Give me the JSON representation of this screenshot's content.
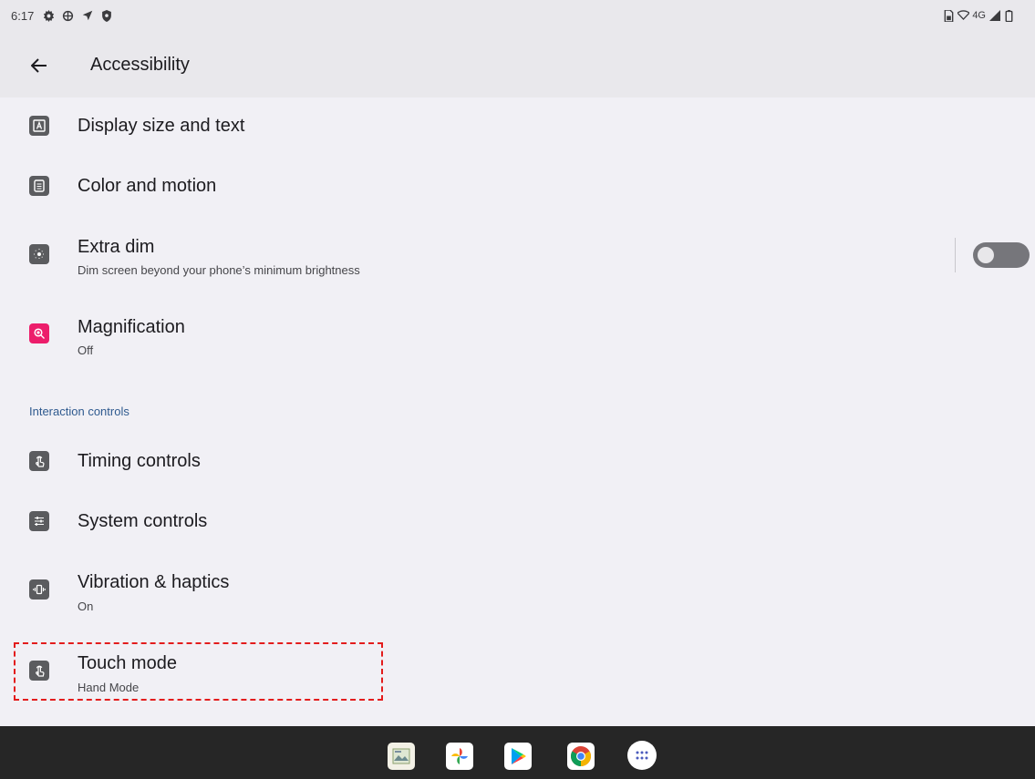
{
  "status_bar": {
    "time": "6:17",
    "network": "4G"
  },
  "app_bar": {
    "title": "Accessibility"
  },
  "items": [
    {
      "title": "Display size and text",
      "subtitle": "",
      "icon": "display-size-icon"
    },
    {
      "title": "Color and motion",
      "subtitle": "",
      "icon": "color-motion-icon"
    },
    {
      "title": "Extra dim",
      "subtitle": "Dim screen beyond your phone’s minimum brightness",
      "icon": "extra-dim-icon",
      "toggle_on": false
    },
    {
      "title": "Magnification",
      "subtitle": "Off",
      "icon": "magnification-icon"
    }
  ],
  "section_interaction": {
    "header": "Interaction controls",
    "items": [
      {
        "title": "Timing controls",
        "subtitle": "",
        "icon": "timing-icon"
      },
      {
        "title": "System controls",
        "subtitle": "",
        "icon": "system-controls-icon"
      },
      {
        "title": "Vibration & haptics",
        "subtitle": "On",
        "icon": "vibration-icon"
      },
      {
        "title": "Touch mode",
        "subtitle": "Hand Mode",
        "icon": "touch-mode-icon",
        "highlighted": true
      }
    ]
  },
  "dock": {
    "apps": [
      "gallery-app-icon",
      "photos-app-icon",
      "play-store-app-icon",
      "chrome-app-icon",
      "app-drawer-icon"
    ]
  },
  "colors": {
    "header_bg": "#e9e8ec",
    "content_bg": "#f1f0f5",
    "accent_text": "#2f5a8f",
    "magnification_icon": "#ec1d6b",
    "highlight": "#e31c1c",
    "dock_bg": "#262626"
  }
}
